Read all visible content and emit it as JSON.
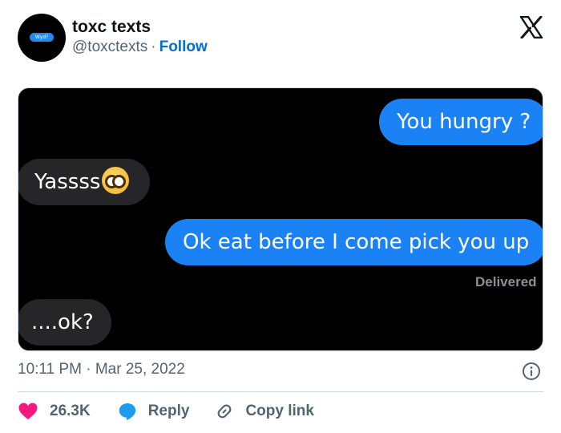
{
  "account": {
    "name": "toxc texts",
    "handle": "@toxctexts",
    "separator": "·",
    "follow_label": "Follow",
    "avatar_text": "Wyd?"
  },
  "messages": {
    "m1": "You hungry ?",
    "m2": "Yassss",
    "m3": "Ok eat before I come pick you up",
    "status": "Delivered",
    "m4": "....ok?"
  },
  "meta": {
    "time": "10:11 PM",
    "separator": "·",
    "date": "Mar 25, 2022"
  },
  "actions": {
    "likes": "26.3K",
    "reply": "Reply",
    "copy_link": "Copy link"
  },
  "colors": {
    "outgoing_bubble": "#1b82f6",
    "incoming_bubble": "#262628",
    "link_blue": "#006fd6",
    "heart": "#f91880",
    "reply_icon": "#1d9bf0"
  },
  "icons": [
    "x-logo-icon",
    "info-icon",
    "heart-icon",
    "reply-bubble-icon",
    "link-icon"
  ]
}
